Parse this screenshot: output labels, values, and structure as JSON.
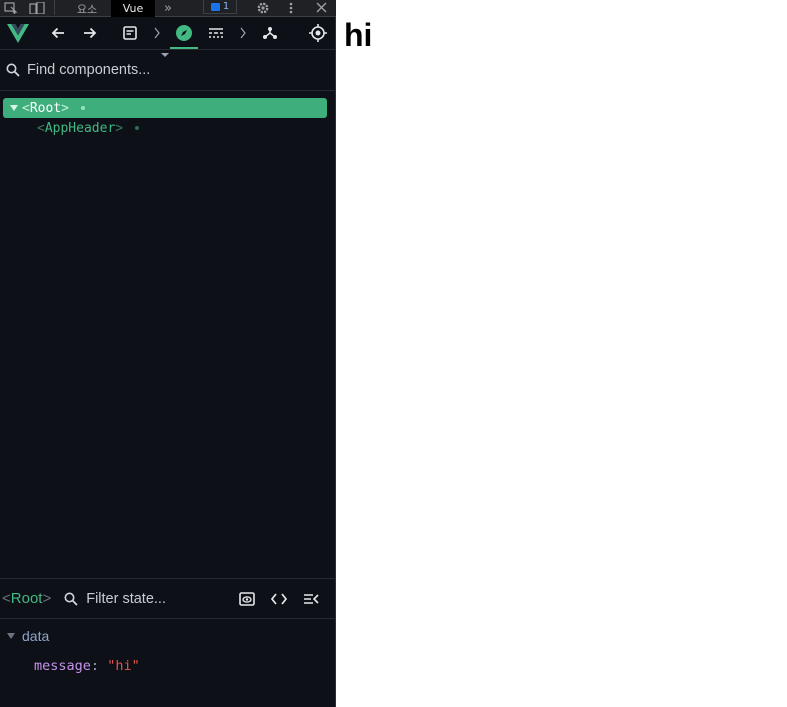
{
  "chrome_tabs": {
    "elements_label": "요소",
    "vue_label": "Vue",
    "issues_count": "1"
  },
  "toolbar": {
    "items": [
      "vue-logo",
      "back-arrow-icon",
      "forward-arrow-icon",
      "inspector-icon",
      "compass-icon",
      "timeline-icon",
      "routes-icon",
      "target-icon"
    ],
    "active_item": "compass-icon"
  },
  "search": {
    "placeholder": "Find components..."
  },
  "tree": {
    "root": {
      "open": "<",
      "name": "Root",
      "close": ">"
    },
    "children": [
      {
        "open": "<",
        "name": "AppHeader",
        "close": ">"
      }
    ]
  },
  "inspector": {
    "selected_open": "<",
    "selected_name": "Root",
    "selected_close": ">",
    "filter_placeholder": "Filter state..."
  },
  "state": {
    "section_title": "data",
    "rows": [
      {
        "key": "message",
        "colon": ":",
        "value": "\"hi\""
      }
    ]
  },
  "app": {
    "heading": "hi"
  },
  "colors": {
    "vue_green": "#42b883",
    "selected_row": "#3eaf7c",
    "panel_bg": "#0d1117",
    "string_value": "#e5534b",
    "state_key": "#c792ea"
  }
}
